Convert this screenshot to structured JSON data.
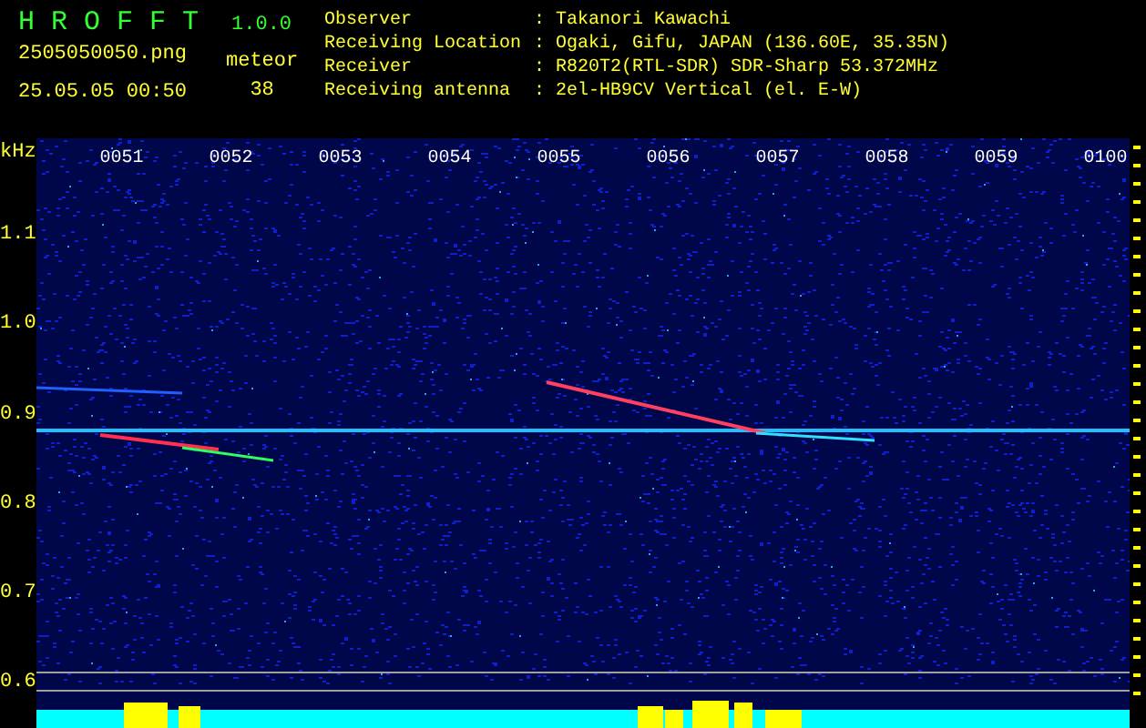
{
  "header": {
    "title": "H R O F F T",
    "version": "1.0.0",
    "filename": "2505050050.png",
    "date": "25.05.05 00:50",
    "meteor_label": "meteor",
    "meteor_count": "38"
  },
  "info": [
    {
      "label": "Observer",
      "value": ": Takanori Kawachi"
    },
    {
      "label": "Receiving Location",
      "value": ": Ogaki, Gifu, JAPAN (136.60E, 35.35N)"
    },
    {
      "label": "Receiver",
      "value": ": R820T2(RTL-SDR) SDR-Sharp 53.372MHz"
    },
    {
      "label": "Receiving antenna",
      "value": ": 2el-HB9CV Vertical (el. E-W)"
    }
  ],
  "spectrogram": {
    "unit": "kHz",
    "time_labels": [
      "0051",
      "0052",
      "0053",
      "0054",
      "0055",
      "0056",
      "0057",
      "0058",
      "0059",
      "0100"
    ],
    "freq_labels": [
      "1.1",
      "1.0",
      "0.9",
      "0.8",
      "0.7",
      "0.6"
    ]
  }
}
